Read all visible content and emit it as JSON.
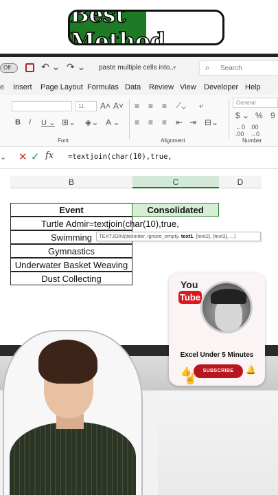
{
  "banner": {
    "text": "Best Method"
  },
  "titlebar": {
    "toggle": "Off",
    "doc_title": "paste multiple cells into...",
    "search_placeholder": "Search"
  },
  "ribbon": {
    "tabs": [
      "e",
      "Insert",
      "Page Layout",
      "Formulas",
      "Data",
      "Review",
      "View",
      "Developer",
      "Help"
    ],
    "active_tab_index": 0,
    "font_size": "11",
    "number_format": "General",
    "groups": {
      "font": "Font",
      "alignment": "Alignment",
      "number": "Number"
    }
  },
  "formula_bar": {
    "formula": "=textjoin(char(10),true,"
  },
  "grid": {
    "columns": [
      "B",
      "C",
      "D"
    ],
    "selected_column": "C",
    "header_event": "Event",
    "header_consolidated": "Consolidated",
    "rows": [
      {
        "event": "Turtle Admir",
        "formula": "=textjoin(char(10),true,"
      },
      {
        "event": "Swimming"
      },
      {
        "event": "Gymnastics"
      },
      {
        "event": "Underwater Basket Weaving"
      },
      {
        "event": "Dust Collecting"
      }
    ],
    "tooltip": {
      "prefix": "TEXTJOIN(delimiter, ignore_empty, ",
      "bold": "text1",
      "suffix": ", [text2], [text3], ...)"
    }
  },
  "youtube_card": {
    "logo_you": "You",
    "logo_tube": "Tube",
    "channel_name": "Excel Under 5 Minutes",
    "subscribe_label": "SUBSCRIBE"
  },
  "colors": {
    "banner_green": "#1e7a25",
    "excel_green": "#1e7a3c",
    "subscribe_red": "#b8171f",
    "cancel_red": "#c0392b"
  }
}
